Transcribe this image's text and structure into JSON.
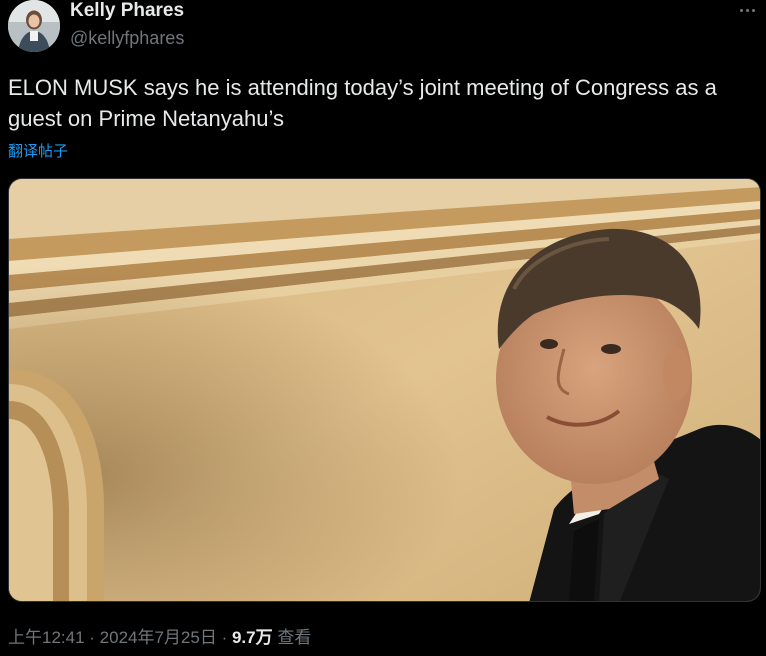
{
  "author": {
    "display_name": "Kelly Phares",
    "handle": "@kellyfphares",
    "avatar_icon": "profile-photo"
  },
  "tweet": {
    "text": "ELON MUSK says he is attending today’s joint meeting of Congress as a guest on Prime Netanyahu’s",
    "translate_label": "翻译帖子"
  },
  "media": {
    "type": "video-still"
  },
  "meta": {
    "time": "上午12:41",
    "separator1": " · ",
    "date": "2024年7月25日",
    "separator2": " · ",
    "views_count": "9.7万",
    "views_label": " 查看"
  },
  "colors": {
    "background": "#000000",
    "text_primary": "#e7e9ea",
    "text_secondary": "#71767b",
    "link": "#1d9bf0"
  }
}
